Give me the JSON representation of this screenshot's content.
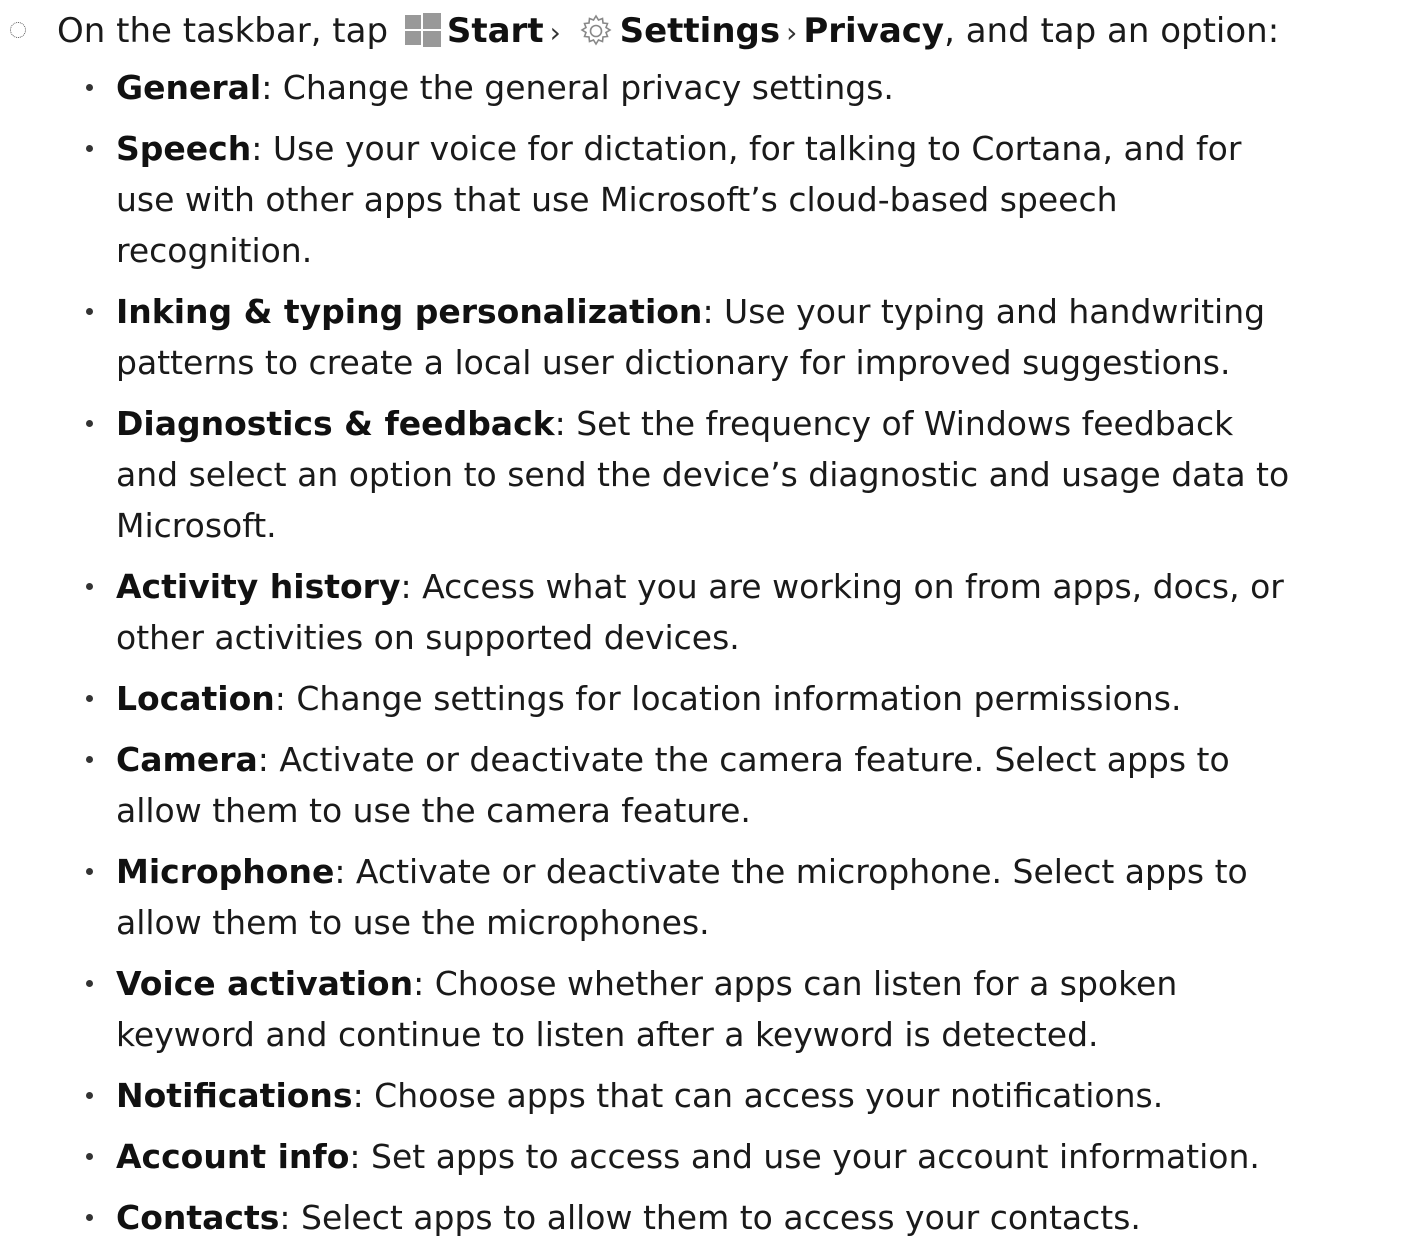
{
  "step": {
    "prefix": "On the taskbar, tap",
    "start_label": "Start",
    "separator_1": "›",
    "settings_label": "Settings",
    "separator_2": "›",
    "privacy_label": "Privacy",
    "suffix": ", and tap an option:",
    "icons": [
      "windows-start-icon",
      "gear-icon"
    ],
    "colors": {
      "windows_icon": "#999999",
      "gear_icon": "#888888"
    }
  },
  "options": [
    {
      "name": "General",
      "description": ": Change the general privacy settings."
    },
    {
      "name": "Speech",
      "description": ": Use your voice for dictation, for talking to Cortana, and for use with other apps that use Microsoft’s cloud-based speech recognition."
    },
    {
      "name": "Inking & typing personalization",
      "description": ": Use your typing and handwriting patterns to create a local user dictionary for improved suggestions."
    },
    {
      "name": "Diagnostics & feedback",
      "description": ": Set the frequency of Windows feedback and select an option to send the device’s diagnostic and usage data to Microsoft."
    },
    {
      "name": "Activity history",
      "description": ": Access what you are working on from apps, docs, or other activities on supported devices."
    },
    {
      "name": "Location",
      "description": ": Change settings for location information permissions."
    },
    {
      "name": "Camera",
      "description": ": Activate or deactivate the camera feature. Select apps to allow them to use the camera feature."
    },
    {
      "name": "Microphone",
      "description": ": Activate or deactivate the microphone. Select apps to allow them to use the microphones."
    },
    {
      "name": "Voice activation",
      "description": ": Choose whether apps can listen for a spoken keyword and continue to listen after a keyword is detected."
    },
    {
      "name": "Notifications",
      "description": ": Choose apps that can access your notifications."
    },
    {
      "name": "Account info",
      "description": ": Set apps to access and use your account information."
    },
    {
      "name": "Contacts",
      "description": ": Select apps to allow them to access your contacts."
    }
  ]
}
